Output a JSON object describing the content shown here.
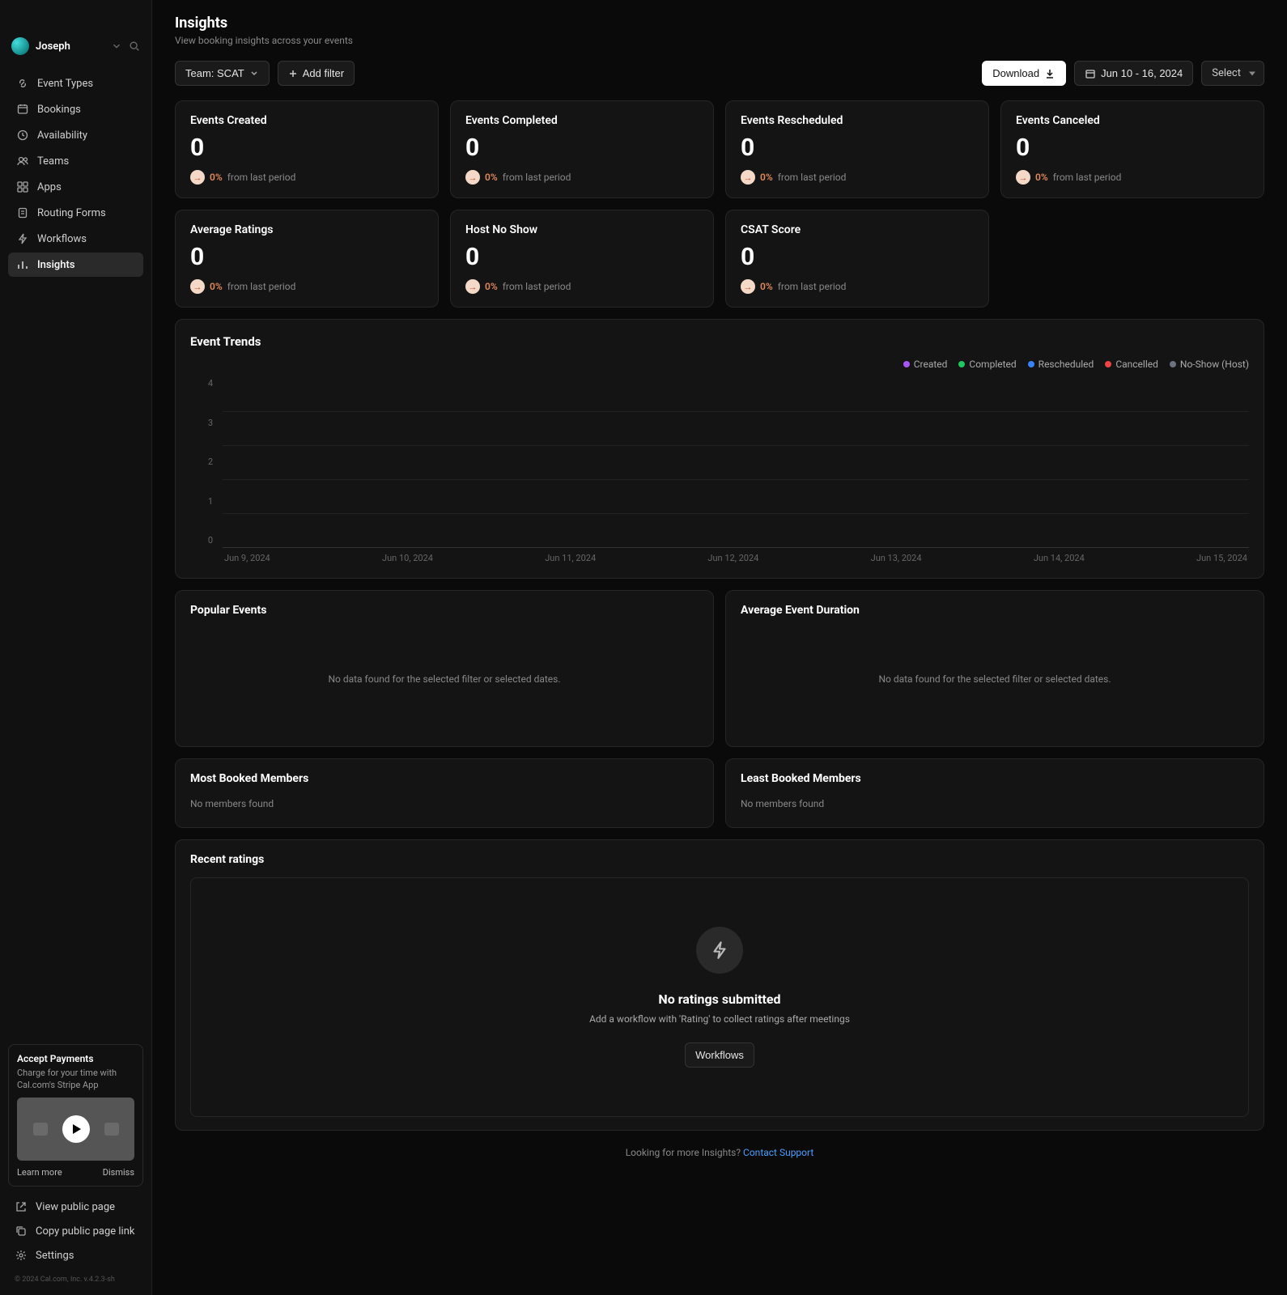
{
  "user": {
    "name": "Joseph"
  },
  "sidebar": {
    "items": [
      {
        "label": "Event Types",
        "icon": "link"
      },
      {
        "label": "Bookings",
        "icon": "calendar"
      },
      {
        "label": "Availability",
        "icon": "clock"
      },
      {
        "label": "Teams",
        "icon": "users"
      },
      {
        "label": "Apps",
        "icon": "grid"
      },
      {
        "label": "Routing Forms",
        "icon": "clipboard"
      },
      {
        "label": "Workflows",
        "icon": "zap"
      },
      {
        "label": "Insights",
        "icon": "bar-chart",
        "active": true
      }
    ],
    "bottom": [
      {
        "label": "View public page",
        "icon": "external"
      },
      {
        "label": "Copy public page link",
        "icon": "copy"
      },
      {
        "label": "Settings",
        "icon": "gear"
      }
    ]
  },
  "promo": {
    "title": "Accept Payments",
    "text": "Charge for your time with Cal.com's Stripe App",
    "learn": "Learn more",
    "dismiss": "Dismiss"
  },
  "copyright": "© 2024 Cal.com, Inc. v.4.2.3-sh",
  "page": {
    "title": "Insights",
    "subtitle": "View booking insights across your events"
  },
  "toolbar": {
    "team_filter": "Team: SCAT",
    "add_filter": "Add filter",
    "download": "Download",
    "date_range": "Jun 10 - 16, 2024",
    "select": "Select"
  },
  "kpis": [
    {
      "label": "Events Created",
      "value": "0",
      "pct": "0%",
      "text": "from last period"
    },
    {
      "label": "Events Completed",
      "value": "0",
      "pct": "0%",
      "text": "from last period"
    },
    {
      "label": "Events Rescheduled",
      "value": "0",
      "pct": "0%",
      "text": "from last period"
    },
    {
      "label": "Events Canceled",
      "value": "0",
      "pct": "0%",
      "text": "from last period"
    },
    {
      "label": "Average Ratings",
      "value": "0",
      "pct": "0%",
      "text": "from last period"
    },
    {
      "label": "Host No Show",
      "value": "0",
      "pct": "0%",
      "text": "from last period"
    },
    {
      "label": "CSAT Score",
      "value": "0",
      "pct": "0%",
      "text": "from last period"
    }
  ],
  "chart": {
    "title": "Event Trends",
    "legend": [
      {
        "label": "Created",
        "color": "#a855f7"
      },
      {
        "label": "Completed",
        "color": "#22c55e"
      },
      {
        "label": "Rescheduled",
        "color": "#3b82f6"
      },
      {
        "label": "Cancelled",
        "color": "#ef4444"
      },
      {
        "label": "No-Show (Host)",
        "color": "#6b7280"
      }
    ],
    "y_ticks": [
      "4",
      "3",
      "2",
      "1",
      "0"
    ],
    "x_ticks": [
      "Jun 9, 2024",
      "Jun 10, 2024",
      "Jun 11, 2024",
      "Jun 12, 2024",
      "Jun 13, 2024",
      "Jun 14, 2024",
      "Jun 15, 2024"
    ]
  },
  "chart_data": {
    "type": "line",
    "title": "Event Trends",
    "xlabel": "",
    "ylabel": "",
    "ylim": [
      0,
      4
    ],
    "categories": [
      "Jun 9, 2024",
      "Jun 10, 2024",
      "Jun 11, 2024",
      "Jun 12, 2024",
      "Jun 13, 2024",
      "Jun 14, 2024",
      "Jun 15, 2024"
    ],
    "series": [
      {
        "name": "Created",
        "values": [
          0,
          0,
          0,
          0,
          0,
          0,
          0
        ]
      },
      {
        "name": "Completed",
        "values": [
          0,
          0,
          0,
          0,
          0,
          0,
          0
        ]
      },
      {
        "name": "Rescheduled",
        "values": [
          0,
          0,
          0,
          0,
          0,
          0,
          0
        ]
      },
      {
        "name": "Cancelled",
        "values": [
          0,
          0,
          0,
          0,
          0,
          0,
          0
        ]
      },
      {
        "name": "No-Show (Host)",
        "values": [
          0,
          0,
          0,
          0,
          0,
          0,
          0
        ]
      }
    ]
  },
  "panels": {
    "popular": {
      "title": "Popular Events",
      "empty": "No data found for the selected filter or selected dates."
    },
    "duration": {
      "title": "Average Event Duration",
      "empty": "No data found for the selected filter or selected dates."
    },
    "most_booked": {
      "title": "Most Booked Members",
      "empty": "No members found"
    },
    "least_booked": {
      "title": "Least Booked Members",
      "empty": "No members found"
    }
  },
  "ratings": {
    "title": "Recent ratings",
    "empty_title": "No ratings submitted",
    "empty_sub": "Add a workflow with 'Rating' to collect ratings after meetings",
    "cta": "Workflows"
  },
  "footer": {
    "text": "Looking for more Insights? ",
    "link": "Contact Support"
  }
}
